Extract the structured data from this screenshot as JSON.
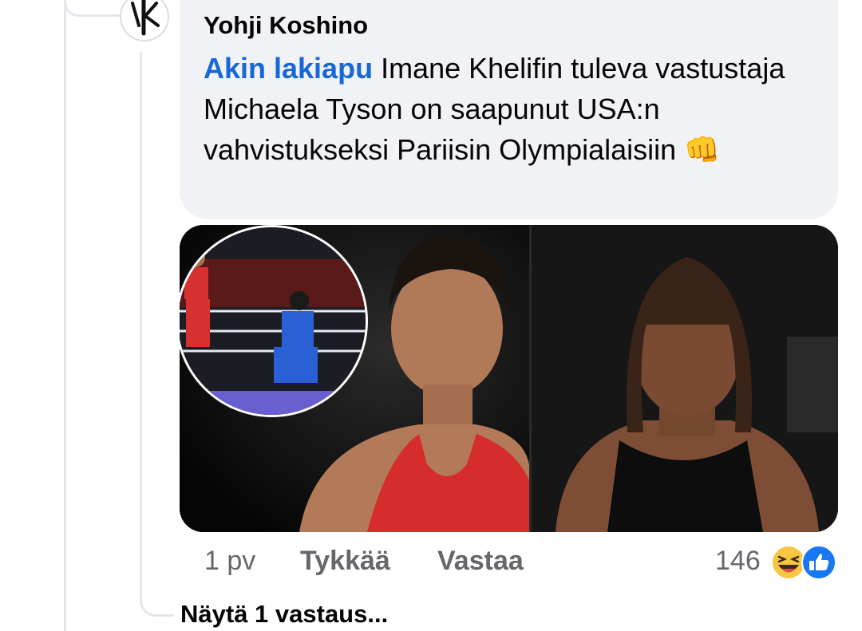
{
  "comment": {
    "author": "Yohji Koshino",
    "mention": "Akin lakiapu",
    "text": " Imane Khelifin tuleva vastustaja Michaela Tyson on saapunut USA:n vahvistukseksi Pariisin Olympialaisiin ",
    "emoji": "👊",
    "time": "1 pv",
    "like_label": "Tykkää",
    "reply_label": "Vastaa",
    "reaction_count": "146",
    "reactions": [
      "laugh-reaction-icon",
      "like-reaction-icon"
    ]
  },
  "replies": {
    "label": "Näytä 1 vastaus..."
  },
  "colors": {
    "mention": "#1867d6",
    "bubble": "#f0f2f5",
    "secondary_text": "#65676b",
    "like_blue": "#1877f2",
    "laugh_yellow": "#f7c744"
  }
}
